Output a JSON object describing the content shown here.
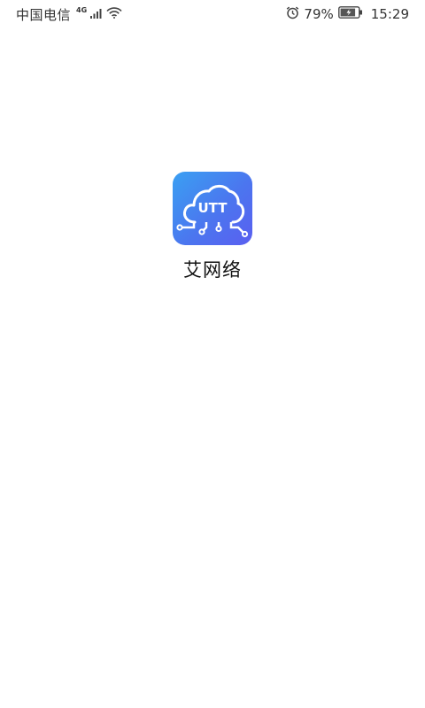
{
  "status_bar": {
    "carrier": "中国电信",
    "network_type": "4G",
    "signal_icon": "signal-bars-icon",
    "wifi_icon": "wifi-icon",
    "alarm_icon": "alarm-clock-icon",
    "battery_percent": "79%",
    "battery_icon": "battery-charging-icon",
    "time": "15:29"
  },
  "splash": {
    "logo_text": "UTT",
    "logo_icon": "cloud-circuit-icon",
    "app_name": "艾网络"
  },
  "colors": {
    "logo_gradient_start": "#3aa0f2",
    "logo_gradient_end": "#5a5ff0",
    "background": "#ffffff"
  }
}
